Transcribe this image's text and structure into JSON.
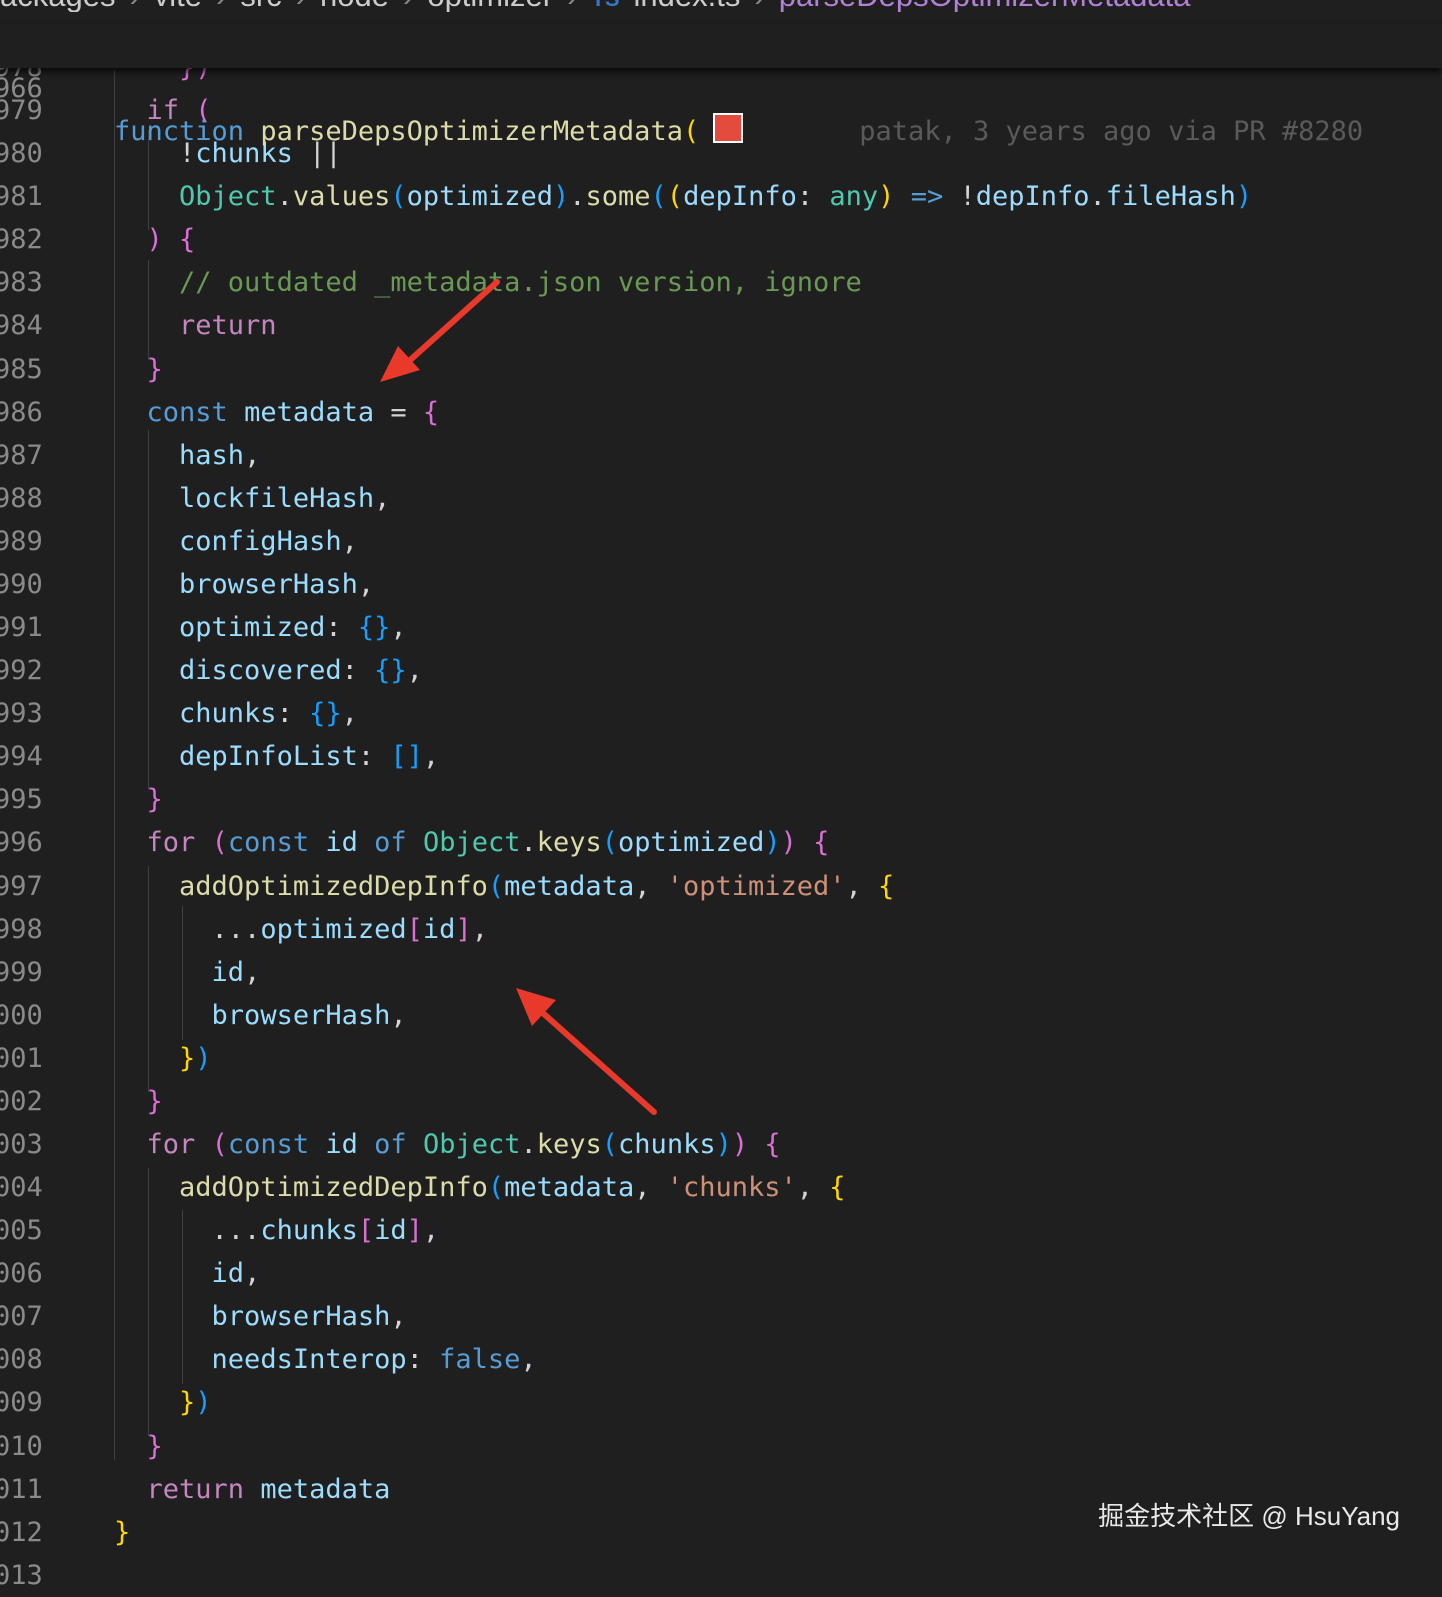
{
  "breadcrumb": [
    "ackages",
    "vite",
    "src",
    "node",
    "optimizer",
    "TS",
    "index.ts",
    "parseDepsOptimizerMetadata"
  ],
  "sticky": {
    "line_number": "966",
    "tokens": [
      {
        "t": "function",
        "c": "kw"
      },
      {
        "t": " "
      },
      {
        "t": "parseDepsOptimizerMetadata",
        "c": "fn"
      },
      {
        "t": "(",
        "c": "p1"
      }
    ],
    "blame": "patak, 3 years ago via PR #8280"
  },
  "lines": [
    {
      "n": "978",
      "tokens": [
        {
          "t": "    "
        },
        {
          "t": "})",
          "c": "p2"
        }
      ]
    },
    {
      "n": "979",
      "tokens": [
        {
          "t": "  "
        },
        {
          "t": "if",
          "c": "ctl"
        },
        {
          "t": " "
        },
        {
          "t": "(",
          "c": "p2"
        }
      ]
    },
    {
      "n": "980",
      "tokens": [
        {
          "t": "    "
        },
        {
          "t": "!",
          "c": "op"
        },
        {
          "t": "chunks",
          "c": "var"
        },
        {
          "t": " || ",
          "c": "op"
        }
      ]
    },
    {
      "n": "981",
      "tokens": [
        {
          "t": "    "
        },
        {
          "t": "Object",
          "c": "cls"
        },
        {
          "t": ".",
          "c": "op"
        },
        {
          "t": "values",
          "c": "fn"
        },
        {
          "t": "(",
          "c": "p3"
        },
        {
          "t": "optimized",
          "c": "var"
        },
        {
          "t": ")",
          "c": "p3"
        },
        {
          "t": ".",
          "c": "op"
        },
        {
          "t": "some",
          "c": "fn"
        },
        {
          "t": "(",
          "c": "p3"
        },
        {
          "t": "(",
          "c": "p1"
        },
        {
          "t": "depInfo",
          "c": "var"
        },
        {
          "t": ": ",
          "c": "op"
        },
        {
          "t": "any",
          "c": "type"
        },
        {
          "t": ")",
          "c": "p1"
        },
        {
          "t": " "
        },
        {
          "t": "=>",
          "c": "kw"
        },
        {
          "t": " "
        },
        {
          "t": "!",
          "c": "op"
        },
        {
          "t": "depInfo",
          "c": "var"
        },
        {
          "t": ".",
          "c": "op"
        },
        {
          "t": "fileHash",
          "c": "var"
        },
        {
          "t": ")",
          "c": "p3"
        }
      ]
    },
    {
      "n": "982",
      "tokens": [
        {
          "t": "  "
        },
        {
          "t": ")",
          "c": "p2"
        },
        {
          "t": " "
        },
        {
          "t": "{",
          "c": "p2"
        }
      ]
    },
    {
      "n": "983",
      "tokens": [
        {
          "t": "    "
        },
        {
          "t": "// outdated _metadata.json version, ignore",
          "c": "com"
        }
      ]
    },
    {
      "n": "984",
      "tokens": [
        {
          "t": "    "
        },
        {
          "t": "return",
          "c": "ctl"
        }
      ]
    },
    {
      "n": "985",
      "tokens": [
        {
          "t": "  "
        },
        {
          "t": "}",
          "c": "p2"
        }
      ]
    },
    {
      "n": "986",
      "tokens": [
        {
          "t": "  "
        },
        {
          "t": "const",
          "c": "kw"
        },
        {
          "t": " "
        },
        {
          "t": "metadata",
          "c": "var"
        },
        {
          "t": " = ",
          "c": "op"
        },
        {
          "t": "{",
          "c": "p2"
        }
      ]
    },
    {
      "n": "987",
      "tokens": [
        {
          "t": "    "
        },
        {
          "t": "hash",
          "c": "var"
        },
        {
          "t": ",",
          "c": "op"
        }
      ]
    },
    {
      "n": "988",
      "tokens": [
        {
          "t": "    "
        },
        {
          "t": "lockfileHash",
          "c": "var"
        },
        {
          "t": ",",
          "c": "op"
        }
      ]
    },
    {
      "n": "989",
      "tokens": [
        {
          "t": "    "
        },
        {
          "t": "configHash",
          "c": "var"
        },
        {
          "t": ",",
          "c": "op"
        }
      ]
    },
    {
      "n": "990",
      "tokens": [
        {
          "t": "    "
        },
        {
          "t": "browserHash",
          "c": "var"
        },
        {
          "t": ",",
          "c": "op"
        }
      ]
    },
    {
      "n": "991",
      "tokens": [
        {
          "t": "    "
        },
        {
          "t": "optimized",
          "c": "var"
        },
        {
          "t": ": ",
          "c": "op"
        },
        {
          "t": "{}",
          "c": "p3"
        },
        {
          "t": ",",
          "c": "op"
        }
      ]
    },
    {
      "n": "992",
      "tokens": [
        {
          "t": "    "
        },
        {
          "t": "discovered",
          "c": "var"
        },
        {
          "t": ": ",
          "c": "op"
        },
        {
          "t": "{}",
          "c": "p3"
        },
        {
          "t": ",",
          "c": "op"
        }
      ]
    },
    {
      "n": "993",
      "tokens": [
        {
          "t": "    "
        },
        {
          "t": "chunks",
          "c": "var"
        },
        {
          "t": ": ",
          "c": "op"
        },
        {
          "t": "{}",
          "c": "p3"
        },
        {
          "t": ",",
          "c": "op"
        }
      ]
    },
    {
      "n": "994",
      "tokens": [
        {
          "t": "    "
        },
        {
          "t": "depInfoList",
          "c": "var"
        },
        {
          "t": ": ",
          "c": "op"
        },
        {
          "t": "[]",
          "c": "p3"
        },
        {
          "t": ",",
          "c": "op"
        }
      ]
    },
    {
      "n": "995",
      "tokens": [
        {
          "t": "  "
        },
        {
          "t": "}",
          "c": "p2"
        }
      ]
    },
    {
      "n": "996",
      "tokens": [
        {
          "t": "  "
        },
        {
          "t": "for",
          "c": "ctl"
        },
        {
          "t": " "
        },
        {
          "t": "(",
          "c": "p2"
        },
        {
          "t": "const",
          "c": "kw"
        },
        {
          "t": " "
        },
        {
          "t": "id",
          "c": "var"
        },
        {
          "t": " "
        },
        {
          "t": "of",
          "c": "kw"
        },
        {
          "t": " "
        },
        {
          "t": "Object",
          "c": "cls"
        },
        {
          "t": ".",
          "c": "op"
        },
        {
          "t": "keys",
          "c": "fn"
        },
        {
          "t": "(",
          "c": "p3"
        },
        {
          "t": "optimized",
          "c": "var"
        },
        {
          "t": ")",
          "c": "p3"
        },
        {
          "t": ")",
          "c": "p2"
        },
        {
          "t": " "
        },
        {
          "t": "{",
          "c": "p2"
        }
      ]
    },
    {
      "n": "997",
      "tokens": [
        {
          "t": "    "
        },
        {
          "t": "addOptimizedDepInfo",
          "c": "fn"
        },
        {
          "t": "(",
          "c": "p3"
        },
        {
          "t": "metadata",
          "c": "var"
        },
        {
          "t": ", ",
          "c": "op"
        },
        {
          "t": "'optimized'",
          "c": "str"
        },
        {
          "t": ", ",
          "c": "op"
        },
        {
          "t": "{",
          "c": "p1"
        }
      ]
    },
    {
      "n": "998",
      "tokens": [
        {
          "t": "      "
        },
        {
          "t": "...",
          "c": "op"
        },
        {
          "t": "optimized",
          "c": "var"
        },
        {
          "t": "[",
          "c": "p2"
        },
        {
          "t": "id",
          "c": "var"
        },
        {
          "t": "]",
          "c": "p2"
        },
        {
          "t": ",",
          "c": "op"
        }
      ]
    },
    {
      "n": "999",
      "tokens": [
        {
          "t": "      "
        },
        {
          "t": "id",
          "c": "var"
        },
        {
          "t": ",",
          "c": "op"
        }
      ]
    },
    {
      "n": "000",
      "tokens": [
        {
          "t": "      "
        },
        {
          "t": "browserHash",
          "c": "var"
        },
        {
          "t": ",",
          "c": "op"
        }
      ]
    },
    {
      "n": "001",
      "tokens": [
        {
          "t": "    "
        },
        {
          "t": "}",
          "c": "p1"
        },
        {
          "t": ")",
          "c": "p3"
        }
      ]
    },
    {
      "n": "002",
      "tokens": [
        {
          "t": "  "
        },
        {
          "t": "}",
          "c": "p2"
        }
      ]
    },
    {
      "n": "003",
      "tokens": [
        {
          "t": "  "
        },
        {
          "t": "for",
          "c": "ctl"
        },
        {
          "t": " "
        },
        {
          "t": "(",
          "c": "p2"
        },
        {
          "t": "const",
          "c": "kw"
        },
        {
          "t": " "
        },
        {
          "t": "id",
          "c": "var"
        },
        {
          "t": " "
        },
        {
          "t": "of",
          "c": "kw"
        },
        {
          "t": " "
        },
        {
          "t": "Object",
          "c": "cls"
        },
        {
          "t": ".",
          "c": "op"
        },
        {
          "t": "keys",
          "c": "fn"
        },
        {
          "t": "(",
          "c": "p3"
        },
        {
          "t": "chunks",
          "c": "var"
        },
        {
          "t": ")",
          "c": "p3"
        },
        {
          "t": ")",
          "c": "p2"
        },
        {
          "t": " "
        },
        {
          "t": "{",
          "c": "p2"
        }
      ]
    },
    {
      "n": "004",
      "tokens": [
        {
          "t": "    "
        },
        {
          "t": "addOptimizedDepInfo",
          "c": "fn"
        },
        {
          "t": "(",
          "c": "p3"
        },
        {
          "t": "metadata",
          "c": "var"
        },
        {
          "t": ", ",
          "c": "op"
        },
        {
          "t": "'chunks'",
          "c": "str"
        },
        {
          "t": ", ",
          "c": "op"
        },
        {
          "t": "{",
          "c": "p1"
        }
      ]
    },
    {
      "n": "005",
      "tokens": [
        {
          "t": "      "
        },
        {
          "t": "...",
          "c": "op"
        },
        {
          "t": "chunks",
          "c": "var"
        },
        {
          "t": "[",
          "c": "p2"
        },
        {
          "t": "id",
          "c": "var"
        },
        {
          "t": "]",
          "c": "p2"
        },
        {
          "t": ",",
          "c": "op"
        }
      ]
    },
    {
      "n": "006",
      "tokens": [
        {
          "t": "      "
        },
        {
          "t": "id",
          "c": "var"
        },
        {
          "t": ",",
          "c": "op"
        }
      ]
    },
    {
      "n": "007",
      "tokens": [
        {
          "t": "      "
        },
        {
          "t": "browserHash",
          "c": "var"
        },
        {
          "t": ",",
          "c": "op"
        }
      ]
    },
    {
      "n": "008",
      "tokens": [
        {
          "t": "      "
        },
        {
          "t": "needsInterop",
          "c": "var"
        },
        {
          "t": ": ",
          "c": "op"
        },
        {
          "t": "false",
          "c": "kw"
        },
        {
          "t": ",",
          "c": "op"
        }
      ]
    },
    {
      "n": "009",
      "tokens": [
        {
          "t": "    "
        },
        {
          "t": "}",
          "c": "p1"
        },
        {
          "t": ")",
          "c": "p3"
        }
      ]
    },
    {
      "n": "010",
      "tokens": [
        {
          "t": "  "
        },
        {
          "t": "}",
          "c": "p2"
        }
      ]
    },
    {
      "n": "011",
      "tokens": [
        {
          "t": "  "
        },
        {
          "t": "return",
          "c": "ctl"
        },
        {
          "t": " "
        },
        {
          "t": "metadata",
          "c": "var"
        }
      ]
    },
    {
      "n": "012",
      "tokens": [
        {
          "t": "}",
          "c": "p1"
        }
      ]
    },
    {
      "n": "013",
      "tokens": []
    }
  ],
  "watermark": "掘金技术社区 @ HsuYang"
}
